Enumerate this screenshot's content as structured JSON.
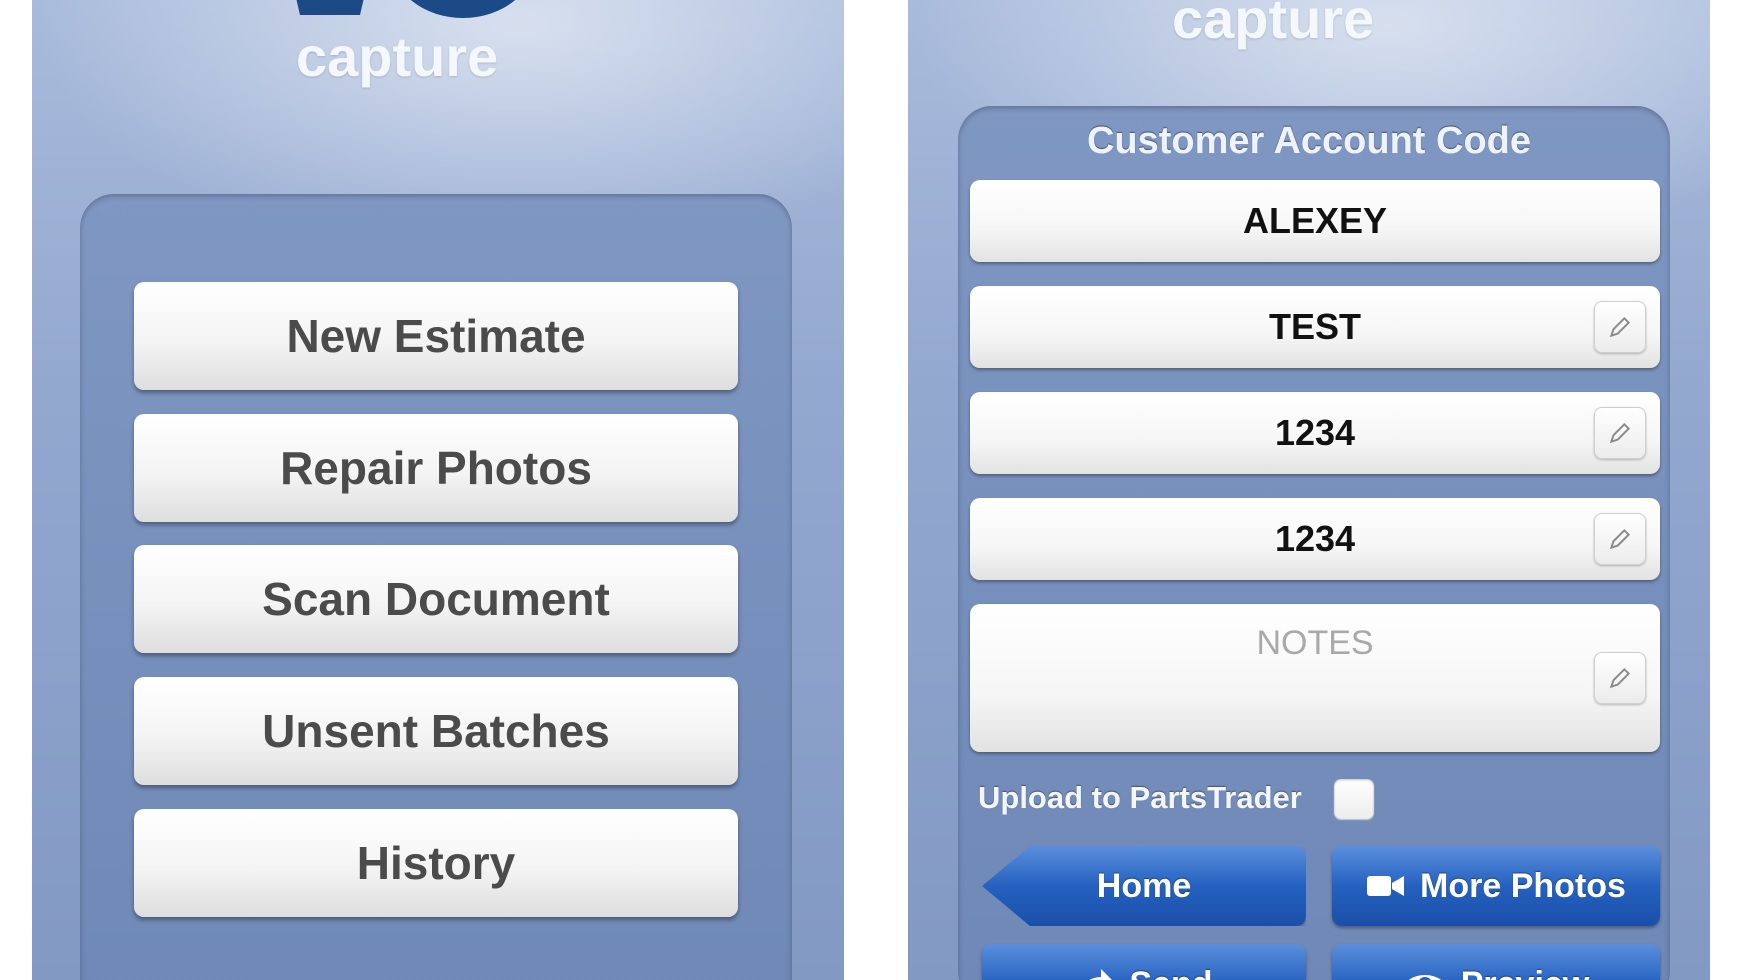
{
  "left_screen": {
    "logo_text": "capture",
    "menu": [
      {
        "label": "New Estimate"
      },
      {
        "label": "Repair Photos"
      },
      {
        "label": "Scan Document"
      },
      {
        "label": "Unsent Batches"
      },
      {
        "label": "History"
      }
    ]
  },
  "right_screen": {
    "logo_text": "capture",
    "panel_title": "Customer Account Code",
    "fields": [
      {
        "value": "ALEXEY",
        "editable": false
      },
      {
        "value": "TEST",
        "editable": true,
        "icon": "pencil-icon"
      },
      {
        "value": "1234",
        "editable": true,
        "icon": "pencil-icon"
      },
      {
        "value": "1234",
        "editable": true,
        "icon": "pencil-icon"
      }
    ],
    "notes": {
      "placeholder": "NOTES",
      "icon": "pencil-icon"
    },
    "upload": {
      "label": "Upload to PartsTrader",
      "checked": false
    },
    "buttons": {
      "home": "Home",
      "more_photos": "More Photos",
      "more_photos_icon": "video-camera-icon",
      "send": "Send",
      "send_icon": "send-arrow-icon",
      "preview": "Preview",
      "preview_icon": "eye-icon"
    }
  },
  "colors": {
    "background_blue": "#93a8cf",
    "panel_blue": "#7690be",
    "logo_blue": "#1c4a86",
    "button_blue": "#2561c0"
  }
}
